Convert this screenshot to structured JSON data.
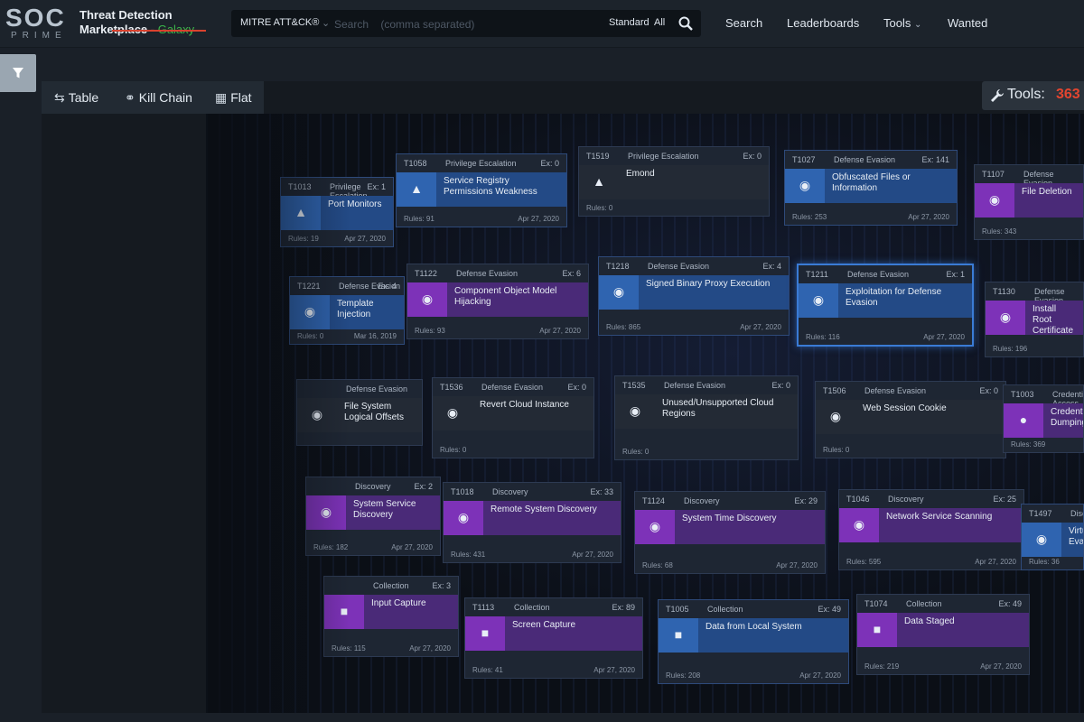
{
  "header": {
    "logo_big": "SOC",
    "logo_small": "PRIME",
    "brand_line1": "Threat Detection",
    "brand_line2": "Marketplace - ",
    "brand_galaxy": "Galaxy",
    "search": {
      "scope": "MITRE ATT&CK®",
      "placeholder": "Search    (comma separated)",
      "value": "",
      "mode": "Standard",
      "filter": "All"
    },
    "nav": [
      {
        "label": "Search"
      },
      {
        "label": "Leaderboards"
      },
      {
        "label": "Tools"
      },
      {
        "label": "Wanted"
      }
    ]
  },
  "view_tabs": [
    {
      "label": "Table",
      "icon": "table-arrows-icon"
    },
    {
      "label": "Kill Chain",
      "icon": "link-icon",
      "active": true
    },
    {
      "label": "Flat",
      "icon": "grid-icon"
    }
  ],
  "tools_counter": {
    "label": "Tools:",
    "count": "363"
  },
  "colors": {
    "accent_red": "#d9422e",
    "purple": "#7d32b8",
    "blue": "#2f64b0",
    "green": "#3ab54a"
  },
  "cards": [
    {
      "id": "T1058",
      "tactic": "Privilege Escalation",
      "ex": "Ex: 0",
      "name": "Service Registry Permissions Weakness",
      "rules": "Rules: 91",
      "date": "Apr 27, 2020",
      "style": "blue",
      "icon": "chevron-up-icon"
    },
    {
      "id": "T1519",
      "tactic": "Privilege Escalation",
      "ex": "Ex: 0",
      "name": "Emond",
      "rules": "Rules: 0",
      "date": "",
      "style": "dark",
      "icon": "chevron-up-icon"
    },
    {
      "id": "T1027",
      "tactic": "Defense Evasion",
      "ex": "Ex: 141",
      "name": "Obfuscated Files or Information",
      "rules": "Rules: 253",
      "date": "Apr 27, 2020",
      "style": "blue",
      "icon": "eye-slash-icon"
    },
    {
      "id": "T1107",
      "tactic": "Defense Evasion",
      "ex": "",
      "name": "File Deletion",
      "rules": "Rules: 343",
      "date": "",
      "style": "purple",
      "icon": "eye-slash-icon"
    },
    {
      "id": "T1013",
      "tactic": "Privilege Escalation",
      "ex": "Ex: 1",
      "name": "Port Monitors",
      "rules": "Rules: 19",
      "date": "Apr 27, 2020",
      "style": "blue",
      "icon": "chevron-up-icon"
    },
    {
      "id": "T1122",
      "tactic": "Defense Evasion",
      "ex": "Ex: 6",
      "name": "Component Object Model Hijacking",
      "rules": "Rules: 93",
      "date": "Apr 27, 2020",
      "style": "purple",
      "icon": "eye-slash-icon"
    },
    {
      "id": "T1218",
      "tactic": "Defense Evasion",
      "ex": "Ex: 4",
      "name": "Signed Binary Proxy Execution",
      "rules": "Rules: 865",
      "date": "Apr 27, 2020",
      "style": "blue",
      "icon": "eye-slash-icon"
    },
    {
      "id": "T1211",
      "tactic": "Defense Evasion",
      "ex": "Ex: 1",
      "name": "Exploitation for Defense Evasion",
      "rules": "Rules: 116",
      "date": "Apr 27, 2020",
      "style": "blue",
      "icon": "eye-slash-icon",
      "highlight": true
    },
    {
      "id": "T1130",
      "tactic": "Defense Evasion",
      "ex": "",
      "name": "Install Root Certificate",
      "rules": "Rules: 196",
      "date": "",
      "style": "purple",
      "icon": "eye-slash-icon"
    },
    {
      "id": "T1221",
      "tactic": "Defense Evasion",
      "ex": "Ex: 4",
      "name": "Template Injection",
      "rules": "Rules: 0",
      "date": "Mar 16, 2019",
      "style": "blue",
      "icon": "eye-slash-icon"
    },
    {
      "id": "T1536",
      "tactic": "Defense Evasion",
      "ex": "Ex: 0",
      "name": "Revert Cloud Instance",
      "rules": "Rules: 0",
      "date": "",
      "style": "dark",
      "icon": "eye-slash-icon"
    },
    {
      "id": "T1535",
      "tactic": "Defense Evasion",
      "ex": "Ex: 0",
      "name": "Unused/Unsupported Cloud Regions",
      "rules": "Rules: 0",
      "date": "",
      "style": "dark",
      "icon": "eye-slash-icon"
    },
    {
      "id": "T1506",
      "tactic": "Defense Evasion",
      "ex": "Ex: 0",
      "name": "Web Session Cookie",
      "rules": "Rules: 0",
      "date": "",
      "style": "dark",
      "icon": "eye-slash-icon"
    },
    {
      "id": "T1003",
      "tactic": "Credential Access",
      "ex": "",
      "name": "Credential Dumping",
      "rules": "Rules: 369",
      "date": "",
      "style": "purple",
      "icon": "person-icon"
    },
    {
      "id": "",
      "tactic": "Defense Evasion",
      "ex": "",
      "name": "File System Logical Offsets",
      "rules": "",
      "date": "",
      "style": "dark",
      "icon": "eye-slash-icon"
    },
    {
      "id": "",
      "tactic": "Discovery",
      "ex": "Ex: 2",
      "name": "System Service Discovery",
      "rules": "Rules: 182",
      "date": "Apr 27, 2020",
      "style": "purple",
      "icon": "eye-icon"
    },
    {
      "id": "T1018",
      "tactic": "Discovery",
      "ex": "Ex: 33",
      "name": "Remote System Discovery",
      "rules": "Rules: 431",
      "date": "Apr 27, 2020",
      "style": "purple",
      "icon": "eye-icon"
    },
    {
      "id": "T1124",
      "tactic": "Discovery",
      "ex": "Ex: 29",
      "name": "System Time Discovery",
      "rules": "Rules: 68",
      "date": "Apr 27, 2020",
      "style": "purple",
      "icon": "eye-icon"
    },
    {
      "id": "T1046",
      "tactic": "Discovery",
      "ex": "Ex: 25",
      "name": "Network Service Scanning",
      "rules": "Rules: 595",
      "date": "Apr 27, 2020",
      "style": "purple",
      "icon": "eye-icon"
    },
    {
      "id": "T1497",
      "tactic": "Discovery",
      "ex": "",
      "name": "Virtualization/Sandbox Evasion",
      "rules": "Rules: 36",
      "date": "",
      "style": "blue",
      "icon": "eye-icon"
    },
    {
      "id": "",
      "tactic": "Collection",
      "ex": "Ex: 3",
      "name": "Input Capture",
      "rules": "Rules: 115",
      "date": "Apr 27, 2020",
      "style": "purple",
      "icon": "box-icon"
    },
    {
      "id": "T1113",
      "tactic": "Collection",
      "ex": "Ex: 89",
      "name": "Screen Capture",
      "rules": "Rules: 41",
      "date": "Apr 27, 2020",
      "style": "purple",
      "icon": "box-icon"
    },
    {
      "id": "T1005",
      "tactic": "Collection",
      "ex": "Ex: 49",
      "name": "Data from Local System",
      "rules": "Rules: 208",
      "date": "Apr 27, 2020",
      "style": "blue",
      "icon": "box-icon"
    },
    {
      "id": "T1074",
      "tactic": "Collection",
      "ex": "Ex: 49",
      "name": "Data Staged",
      "rules": "Rules: 219",
      "date": "Apr 27, 2020",
      "style": "purple",
      "icon": "box-icon"
    }
  ]
}
